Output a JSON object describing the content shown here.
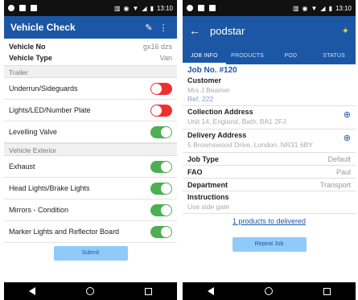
{
  "status_bar": {
    "time": "13:10"
  },
  "vehicle_check": {
    "title": "Vehicle Check",
    "vehicle_no_label": "Vehicle No",
    "vehicle_no_value": "gx16 dzs",
    "vehicle_type_label": "Vehicle Type",
    "vehicle_type_value": "Van",
    "sections": [
      {
        "header": "Trailer",
        "items": [
          {
            "label": "Underrun/Sideguards",
            "state": "off"
          },
          {
            "label": "Lights/LED/Number Plate",
            "state": "off"
          },
          {
            "label": "Levelling Valve",
            "state": "on"
          }
        ]
      },
      {
        "header": "Vehicle Exterior",
        "items": [
          {
            "label": "Exhaust",
            "state": "on"
          },
          {
            "label": "Head Lights/Brake Lights",
            "state": "on"
          },
          {
            "label": "Mirrors - Condition",
            "state": "on"
          },
          {
            "label": "Marker Lights and Reflector Board",
            "state": "on"
          }
        ]
      }
    ],
    "submit_label": "Submit"
  },
  "job_info": {
    "title": "podstar",
    "tabs": [
      "JOB INFO",
      "PRODUCTS",
      "POD",
      "STATUS"
    ],
    "active_tab": 0,
    "job_no": "Job No. #120",
    "customer_label": "Customer",
    "customer_name": "Mrs J Beamer",
    "customer_ref": "Ref. 222",
    "collection_label": "Collection Address",
    "collection_value": "Unit 14, England, Bath, BA1 2FJ",
    "delivery_label": "Delivery Address",
    "delivery_value": "5 Brownswood Drive, London, NR31 6BY",
    "job_type_label": "Job Type",
    "job_type_value": "Default",
    "fao_label": "FAO",
    "fao_value": "Paul",
    "department_label": "Department",
    "department_value": "Transport",
    "instructions_label": "Instructions",
    "instructions_value": "Use side gate",
    "products_link": "1 products to delivered",
    "repeat_label": "Repeat Job"
  },
  "colors": {
    "primary": "#1c57a5",
    "toggle_on": "#4caf50",
    "toggle_off": "#f03030",
    "button": "#90caf9"
  }
}
